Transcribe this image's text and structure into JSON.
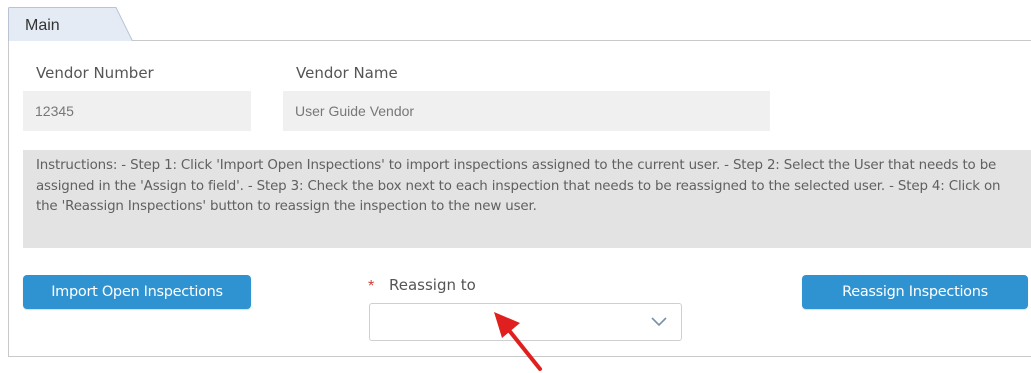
{
  "tabs": [
    {
      "label": "Main"
    }
  ],
  "vendor": {
    "number_label": "Vendor Number",
    "number_value": "12345",
    "name_label": "Vendor Name",
    "name_value": "User Guide Vendor"
  },
  "instructions": "Instructions: - Step 1: Click 'Import Open Inspections' to import inspections assigned to the current user. - Step 2: Select the User that needs to be assigned in the 'Assign to field'. - Step 3: Check the box next to each inspection that needs to be reassigned to the selected user. - Step 4: Click on the 'Reassign Inspections' button to reassign the inspection to the new user.",
  "actions": {
    "import_label": "Import Open Inspections",
    "reassign_label": "Reassign Inspections"
  },
  "reassign_to": {
    "required_marker": "*",
    "label": "Reassign to",
    "selected_value": ""
  },
  "colors": {
    "button": "#2f93d2",
    "tab_fill": "#e4ebf5",
    "arrow": "#e0201e"
  },
  "icons": {
    "dropdown": "chevron-down-icon",
    "annotation": "red-arrow"
  }
}
